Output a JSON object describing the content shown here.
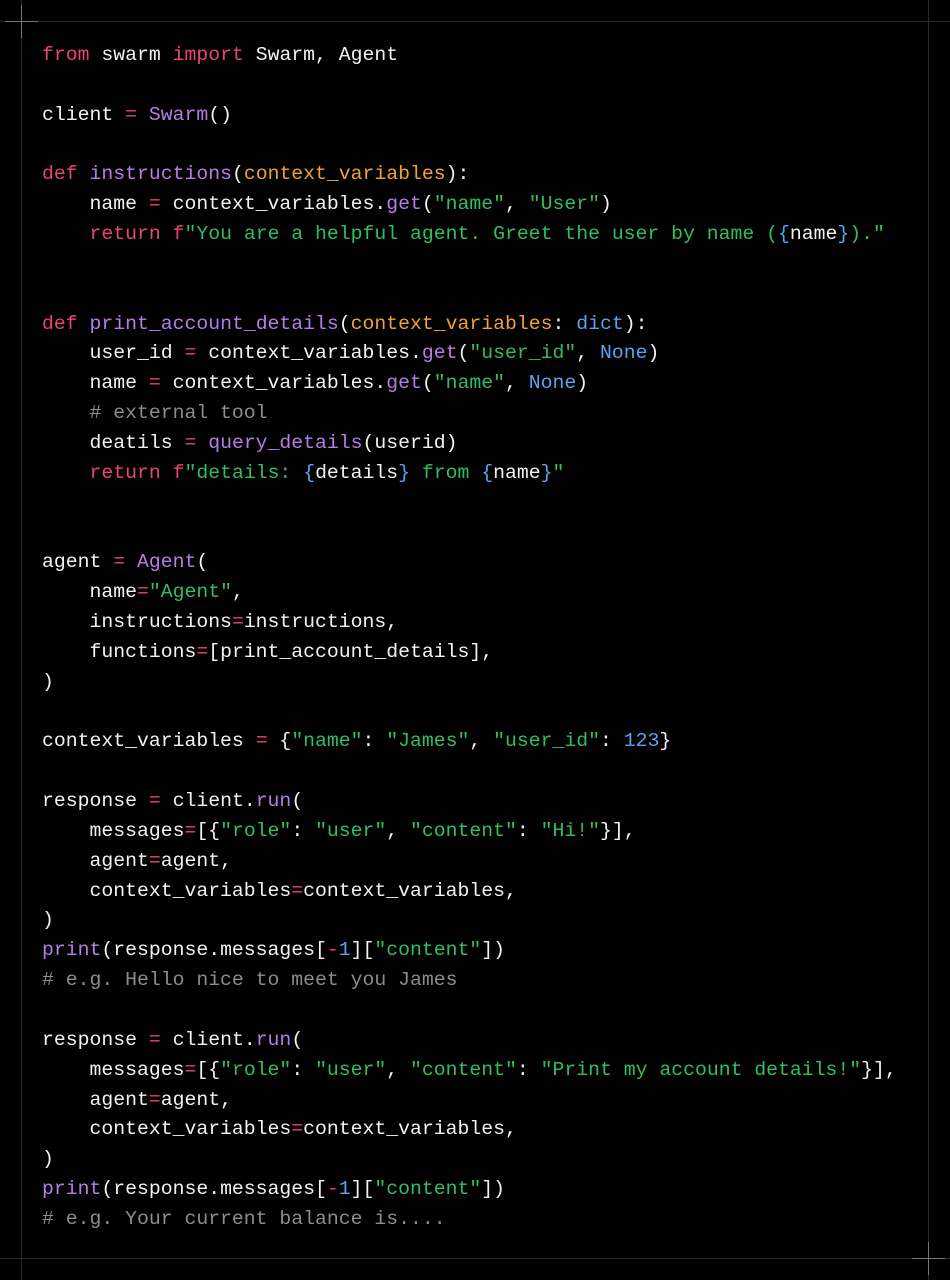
{
  "colors": {
    "keyword": "#e8466e",
    "function": "#b57ee6",
    "parameter": "#f0a334",
    "string": "#2fbf63",
    "number": "#5aa2f2",
    "text": "#f2f2f2",
    "comment": "#8c8c8c",
    "background": "#000000"
  },
  "code_lines": [
    [
      [
        "kw",
        "from"
      ],
      [
        "plain",
        " swarm "
      ],
      [
        "kw",
        "import"
      ],
      [
        "plain",
        " Swarm, Agent"
      ]
    ],
    [],
    [
      [
        "plain",
        "client "
      ],
      [
        "op",
        "="
      ],
      [
        "plain",
        " "
      ],
      [
        "fn",
        "Swarm"
      ],
      [
        "plain",
        "()"
      ]
    ],
    [],
    [
      [
        "kw",
        "def"
      ],
      [
        "plain",
        " "
      ],
      [
        "fn",
        "instructions"
      ],
      [
        "plain",
        "("
      ],
      [
        "param",
        "context_variables"
      ],
      [
        "plain",
        "):"
      ]
    ],
    [
      [
        "plain",
        "    name "
      ],
      [
        "op",
        "="
      ],
      [
        "plain",
        " context_variables."
      ],
      [
        "fn",
        "get"
      ],
      [
        "plain",
        "("
      ],
      [
        "str",
        "\"name\""
      ],
      [
        "plain",
        ", "
      ],
      [
        "str",
        "\"User\""
      ],
      [
        "plain",
        ")"
      ]
    ],
    [
      [
        "plain",
        "    "
      ],
      [
        "kw",
        "return"
      ],
      [
        "plain",
        " "
      ],
      [
        "kw",
        "f"
      ],
      [
        "str",
        "\"You are a helpful agent. Greet the user by name ("
      ],
      [
        "num",
        "{"
      ],
      [
        "plain",
        "name"
      ],
      [
        "num",
        "}"
      ],
      [
        "str",
        ").\""
      ]
    ],
    [],
    [],
    [
      [
        "kw",
        "def"
      ],
      [
        "plain",
        " "
      ],
      [
        "fn",
        "print_account_details"
      ],
      [
        "plain",
        "("
      ],
      [
        "param",
        "context_variables"
      ],
      [
        "plain",
        ": "
      ],
      [
        "num",
        "dict"
      ],
      [
        "plain",
        "):"
      ]
    ],
    [
      [
        "plain",
        "    user_id "
      ],
      [
        "op",
        "="
      ],
      [
        "plain",
        " context_variables."
      ],
      [
        "fn",
        "get"
      ],
      [
        "plain",
        "("
      ],
      [
        "str",
        "\"user_id\""
      ],
      [
        "plain",
        ", "
      ],
      [
        "num",
        "None"
      ],
      [
        "plain",
        ")"
      ]
    ],
    [
      [
        "plain",
        "    name "
      ],
      [
        "op",
        "="
      ],
      [
        "plain",
        " context_variables."
      ],
      [
        "fn",
        "get"
      ],
      [
        "plain",
        "("
      ],
      [
        "str",
        "\"name\""
      ],
      [
        "plain",
        ", "
      ],
      [
        "num",
        "None"
      ],
      [
        "plain",
        ")"
      ]
    ],
    [
      [
        "cm",
        "    # external tool"
      ]
    ],
    [
      [
        "plain",
        "    deatils "
      ],
      [
        "op",
        "="
      ],
      [
        "plain",
        " "
      ],
      [
        "fn",
        "query_details"
      ],
      [
        "plain",
        "(userid)"
      ]
    ],
    [
      [
        "plain",
        "    "
      ],
      [
        "kw",
        "return"
      ],
      [
        "plain",
        " "
      ],
      [
        "kw",
        "f"
      ],
      [
        "str",
        "\"details: "
      ],
      [
        "num",
        "{"
      ],
      [
        "plain",
        "details"
      ],
      [
        "num",
        "}"
      ],
      [
        "str",
        " from "
      ],
      [
        "num",
        "{"
      ],
      [
        "plain",
        "name"
      ],
      [
        "num",
        "}"
      ],
      [
        "str",
        "\""
      ]
    ],
    [],
    [],
    [
      [
        "plain",
        "agent "
      ],
      [
        "op",
        "="
      ],
      [
        "plain",
        " "
      ],
      [
        "fn",
        "Agent"
      ],
      [
        "plain",
        "("
      ]
    ],
    [
      [
        "plain",
        "    name"
      ],
      [
        "op",
        "="
      ],
      [
        "str",
        "\"Agent\""
      ],
      [
        "plain",
        ","
      ]
    ],
    [
      [
        "plain",
        "    instructions"
      ],
      [
        "op",
        "="
      ],
      [
        "plain",
        "instructions,"
      ]
    ],
    [
      [
        "plain",
        "    functions"
      ],
      [
        "op",
        "="
      ],
      [
        "plain",
        "[print_account_details],"
      ]
    ],
    [
      [
        "plain",
        ")"
      ]
    ],
    [],
    [
      [
        "plain",
        "context_variables "
      ],
      [
        "op",
        "="
      ],
      [
        "plain",
        " {"
      ],
      [
        "str",
        "\"name\""
      ],
      [
        "plain",
        ": "
      ],
      [
        "str",
        "\"James\""
      ],
      [
        "plain",
        ", "
      ],
      [
        "str",
        "\"user_id\""
      ],
      [
        "plain",
        ": "
      ],
      [
        "num",
        "123"
      ],
      [
        "plain",
        "}"
      ]
    ],
    [],
    [
      [
        "plain",
        "response "
      ],
      [
        "op",
        "="
      ],
      [
        "plain",
        " client."
      ],
      [
        "fn",
        "run"
      ],
      [
        "plain",
        "("
      ]
    ],
    [
      [
        "plain",
        "    messages"
      ],
      [
        "op",
        "="
      ],
      [
        "plain",
        "[{"
      ],
      [
        "str",
        "\"role\""
      ],
      [
        "plain",
        ": "
      ],
      [
        "str",
        "\"user\""
      ],
      [
        "plain",
        ", "
      ],
      [
        "str",
        "\"content\""
      ],
      [
        "plain",
        ": "
      ],
      [
        "str",
        "\"Hi!\""
      ],
      [
        "plain",
        "}],"
      ]
    ],
    [
      [
        "plain",
        "    agent"
      ],
      [
        "op",
        "="
      ],
      [
        "plain",
        "agent,"
      ]
    ],
    [
      [
        "plain",
        "    context_variables"
      ],
      [
        "op",
        "="
      ],
      [
        "plain",
        "context_variables,"
      ]
    ],
    [
      [
        "plain",
        ")"
      ]
    ],
    [
      [
        "fn",
        "print"
      ],
      [
        "plain",
        "(response.messages["
      ],
      [
        "op",
        "-"
      ],
      [
        "num",
        "1"
      ],
      [
        "plain",
        "]["
      ],
      [
        "str",
        "\"content\""
      ],
      [
        "plain",
        "])"
      ]
    ],
    [
      [
        "cm",
        "# e.g. Hello nice to meet you James"
      ]
    ],
    [],
    [
      [
        "plain",
        "response "
      ],
      [
        "op",
        "="
      ],
      [
        "plain",
        " client."
      ],
      [
        "fn",
        "run"
      ],
      [
        "plain",
        "("
      ]
    ],
    [
      [
        "plain",
        "    messages"
      ],
      [
        "op",
        "="
      ],
      [
        "plain",
        "[{"
      ],
      [
        "str",
        "\"role\""
      ],
      [
        "plain",
        ": "
      ],
      [
        "str",
        "\"user\""
      ],
      [
        "plain",
        ", "
      ],
      [
        "str",
        "\"content\""
      ],
      [
        "plain",
        ": "
      ],
      [
        "str",
        "\"Print my account details!\""
      ],
      [
        "plain",
        "}],"
      ]
    ],
    [
      [
        "plain",
        "    agent"
      ],
      [
        "op",
        "="
      ],
      [
        "plain",
        "agent,"
      ]
    ],
    [
      [
        "plain",
        "    context_variables"
      ],
      [
        "op",
        "="
      ],
      [
        "plain",
        "context_variables,"
      ]
    ],
    [
      [
        "plain",
        ")"
      ]
    ],
    [
      [
        "fn",
        "print"
      ],
      [
        "plain",
        "(response.messages["
      ],
      [
        "op",
        "-"
      ],
      [
        "num",
        "1"
      ],
      [
        "plain",
        "]["
      ],
      [
        "str",
        "\"content\""
      ],
      [
        "plain",
        "])"
      ]
    ],
    [
      [
        "cm",
        "# e.g. Your current balance is...."
      ]
    ]
  ]
}
